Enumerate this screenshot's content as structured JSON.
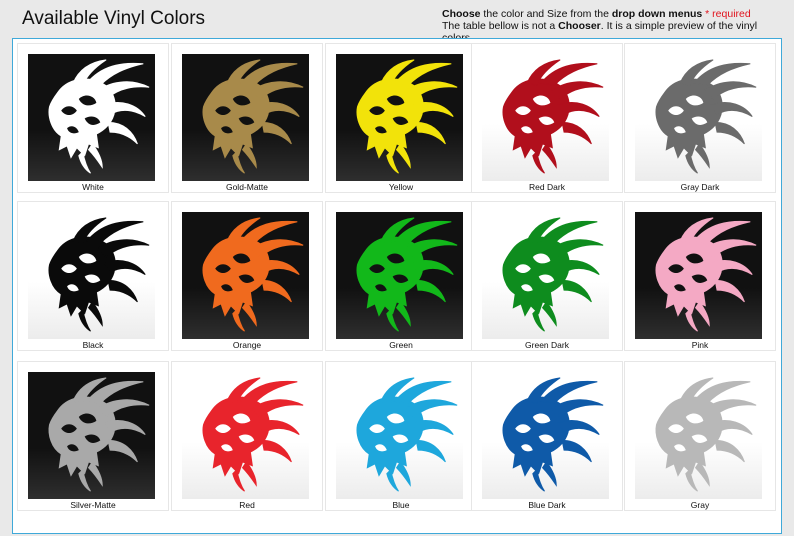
{
  "header": {
    "title": "Available Vinyl Colors",
    "note_part1_bold": "Choose",
    "note_part2": " the color and Size from the ",
    "note_part3_bold": "drop down menus",
    "note_required": " * required",
    "note_line2_a": "The table bellow is not a ",
    "note_line2_bold": "Chooser",
    "note_line2_b": ". It is a simple preview of the vinyl colors."
  },
  "swatches": [
    {
      "label": "White",
      "color": "#ffffff",
      "bg": "dark"
    },
    {
      "label": "Gold-Matte",
      "color": "#a88a4a",
      "bg": "dark"
    },
    {
      "label": "Yellow",
      "color": "#f2e30a",
      "bg": "dark"
    },
    {
      "label": "Red Dark",
      "color": "#b10f1c",
      "bg": "light"
    },
    {
      "label": "Gray Dark",
      "color": "#6b6b6b",
      "bg": "light"
    },
    {
      "label": "Black",
      "color": "#0a0a0a",
      "bg": "light"
    },
    {
      "label": "Orange",
      "color": "#f06a1e",
      "bg": "dark"
    },
    {
      "label": "Green",
      "color": "#12b81a",
      "bg": "dark"
    },
    {
      "label": "Green Dark",
      "color": "#0e8c1e",
      "bg": "light"
    },
    {
      "label": "Pink",
      "color": "#f4a9c4",
      "bg": "dark"
    },
    {
      "label": "Silver-Matte",
      "color": "#a9a9a9",
      "bg": "dark"
    },
    {
      "label": "Red",
      "color": "#e8242c",
      "bg": "light"
    },
    {
      "label": "Blue",
      "color": "#1ea7dc",
      "bg": "light"
    },
    {
      "label": "Blue Dark",
      "color": "#0f5aa8",
      "bg": "light"
    },
    {
      "label": "Gray",
      "color": "#b8b8b8",
      "bg": "light"
    }
  ]
}
